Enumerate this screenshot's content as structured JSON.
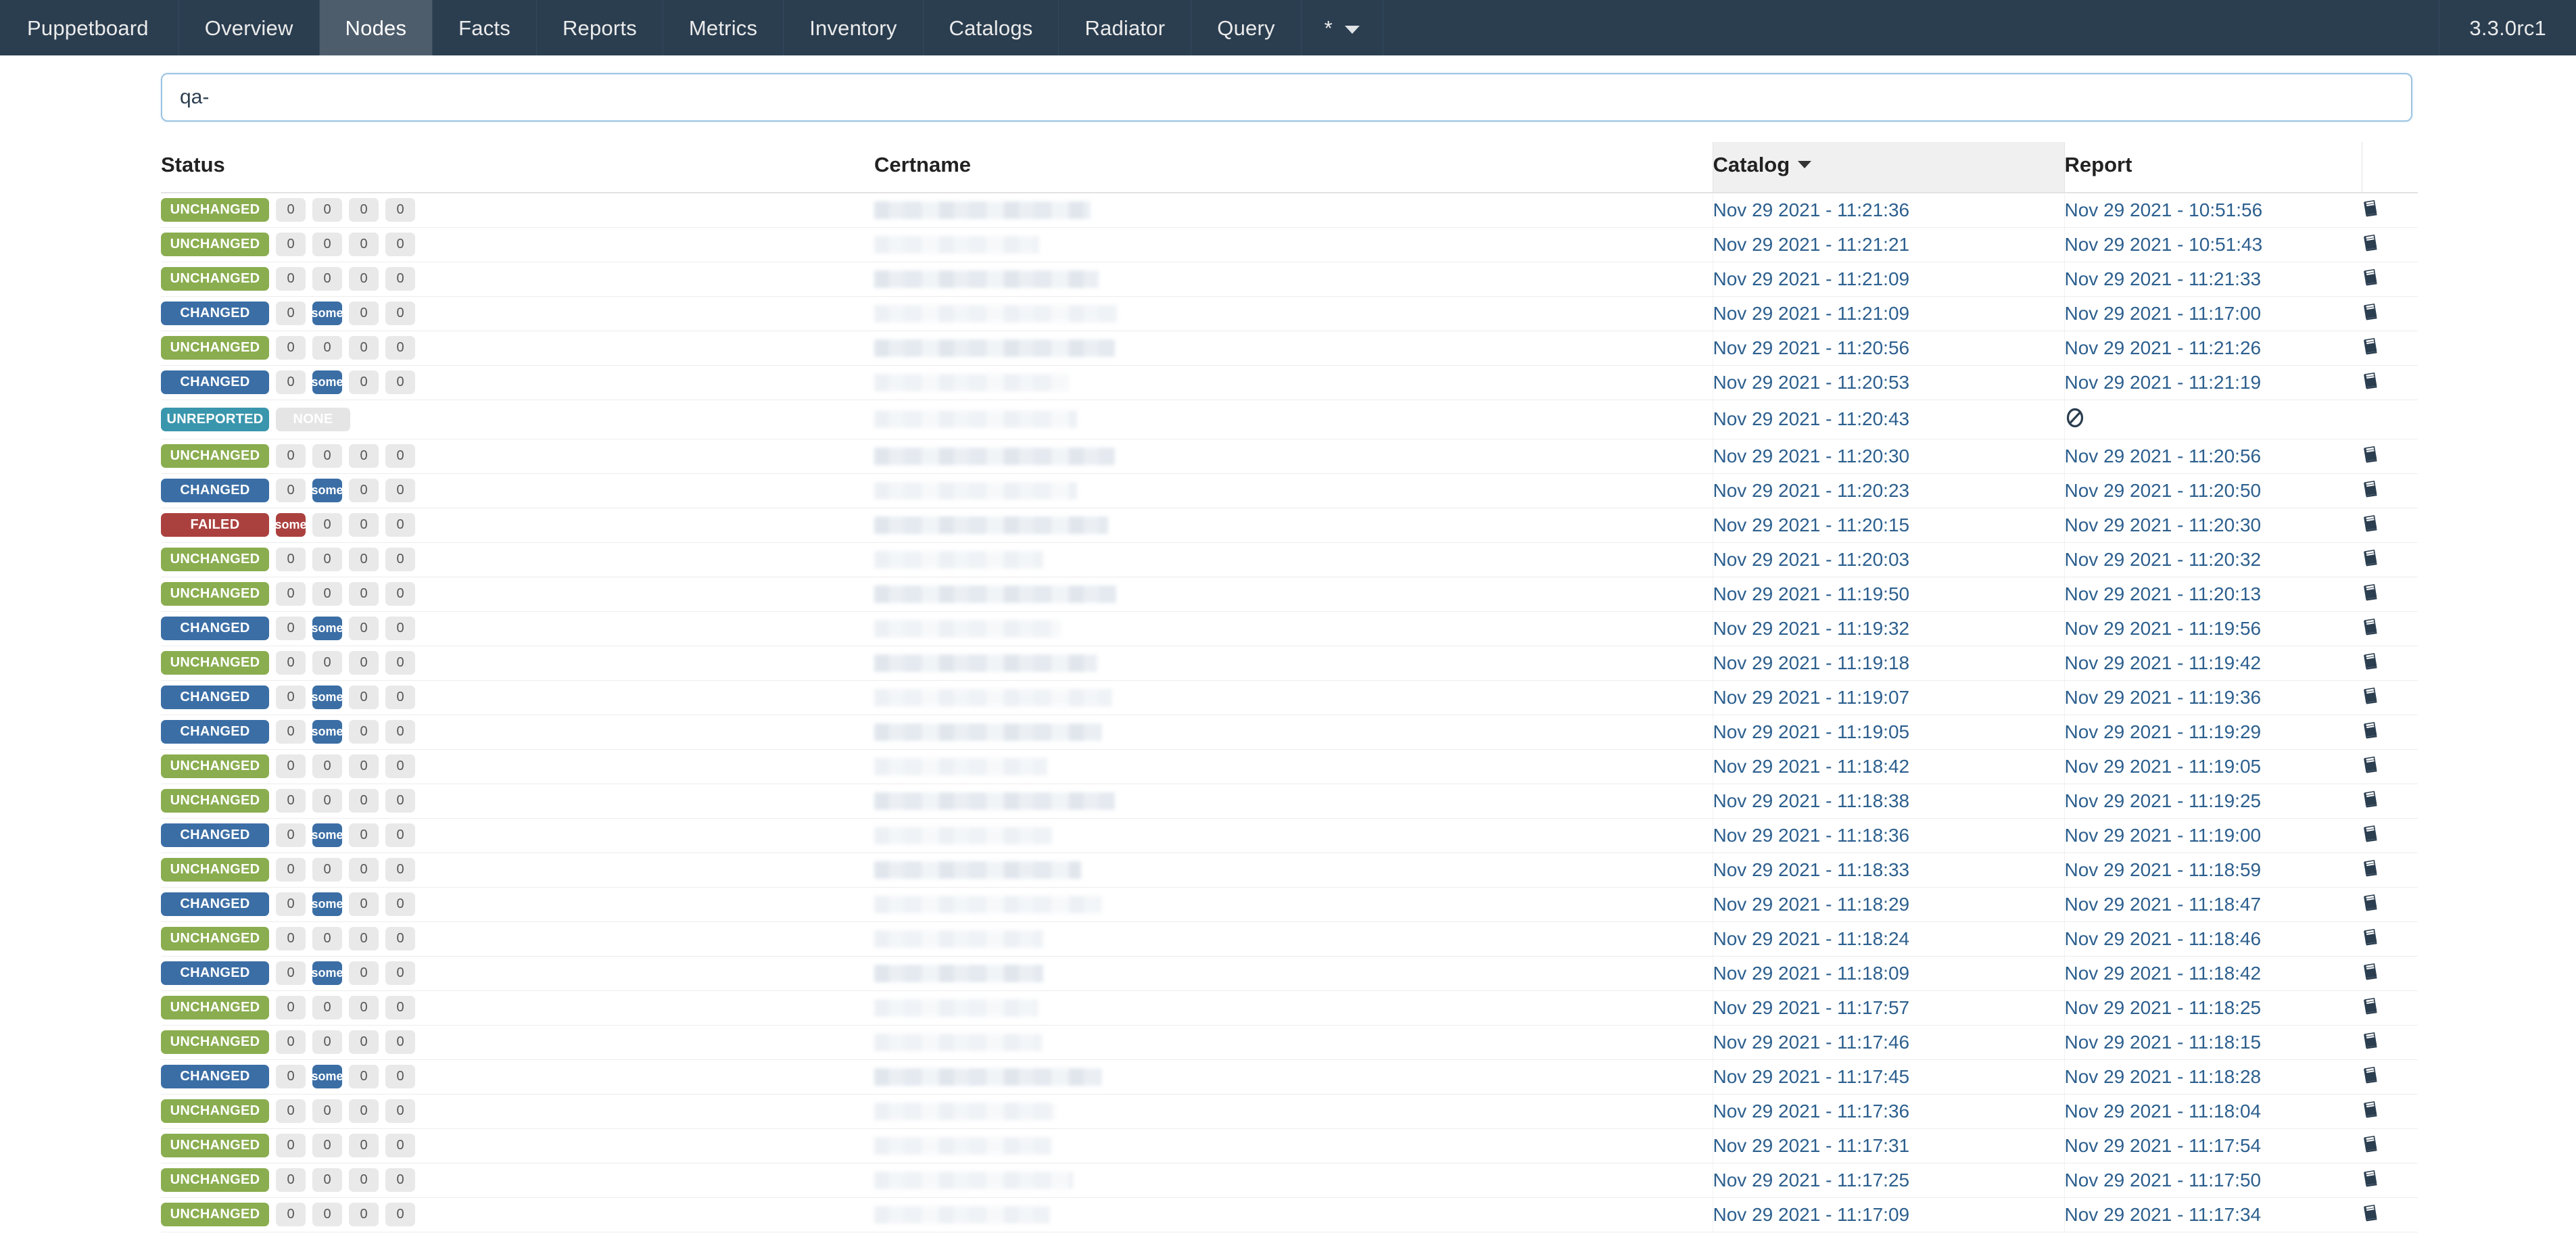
{
  "navbar": {
    "brand": "Puppetboard",
    "items": [
      {
        "label": "Overview",
        "active": false
      },
      {
        "label": "Nodes",
        "active": true
      },
      {
        "label": "Facts",
        "active": false
      },
      {
        "label": "Reports",
        "active": false
      },
      {
        "label": "Metrics",
        "active": false
      },
      {
        "label": "Inventory",
        "active": false
      },
      {
        "label": "Catalogs",
        "active": false
      },
      {
        "label": "Radiator",
        "active": false
      },
      {
        "label": "Query",
        "active": false
      }
    ],
    "env_dropdown_label": "*",
    "version": "3.3.0rc1",
    "colors": {
      "bar_bg": "#2b3e50",
      "active_bg": "#4e5d6c",
      "text": "#ebebeb"
    }
  },
  "search": {
    "value": "qa-",
    "placeholder": ""
  },
  "table": {
    "headers": {
      "status": "Status",
      "certname": "Certname",
      "catalog": "Catalog",
      "report": "Report",
      "logs": ""
    },
    "sorted_column": "catalog",
    "sort_direction": "desc",
    "icons": {
      "sort": "caret-down-icon",
      "logs": "book-icon",
      "no_report": "no-entry-icon"
    },
    "status_colors": {
      "unchanged": "#8aad4f",
      "changed": "#3b6ea5",
      "failed": "#ab413f",
      "unreported": "#3a96ad",
      "count_pill": "#e9e9e9"
    },
    "rows": [
      {
        "status": "UNCHANGED",
        "counts": [
          "0",
          "0",
          "0",
          "0"
        ],
        "certname_width": 320,
        "certname_tone": "solid",
        "catalog": "Nov 29 2021 - 11:21:36",
        "report": "Nov 29 2021 - 10:51:56",
        "has_log": true
      },
      {
        "status": "UNCHANGED",
        "counts": [
          "0",
          "0",
          "0",
          "0"
        ],
        "certname_width": 244,
        "certname_tone": "pale",
        "catalog": "Nov 29 2021 - 11:21:21",
        "report": "Nov 29 2021 - 10:51:43",
        "has_log": true
      },
      {
        "status": "UNCHANGED",
        "counts": [
          "0",
          "0",
          "0",
          "0"
        ],
        "certname_width": 332,
        "certname_tone": "solid",
        "catalog": "Nov 29 2021 - 11:21:09",
        "report": "Nov 29 2021 - 11:21:33",
        "has_log": true
      },
      {
        "status": "CHANGED",
        "counts": [
          "0",
          "some",
          "0",
          "0"
        ],
        "highlight_index": 1,
        "highlight_color": "blue",
        "certname_width": 360,
        "certname_tone": "pale",
        "catalog": "Nov 29 2021 - 11:21:09",
        "report": "Nov 29 2021 - 11:17:00",
        "has_log": true
      },
      {
        "status": "UNCHANGED",
        "counts": [
          "0",
          "0",
          "0",
          "0"
        ],
        "certname_width": 356,
        "certname_tone": "solid",
        "catalog": "Nov 29 2021 - 11:20:56",
        "report": "Nov 29 2021 - 11:21:26",
        "has_log": true
      },
      {
        "status": "CHANGED",
        "counts": [
          "0",
          "some",
          "0",
          "0"
        ],
        "highlight_index": 1,
        "highlight_color": "blue",
        "certname_width": 288,
        "certname_tone": "pale",
        "catalog": "Nov 29 2021 - 11:20:53",
        "report": "Nov 29 2021 - 11:21:19",
        "has_log": true
      },
      {
        "status": "UNREPORTED",
        "counts": [
          "NONE"
        ],
        "none_row": true,
        "certname_width": 300,
        "certname_tone": "pale",
        "catalog": "Nov 29 2021 - 11:20:43",
        "report": "",
        "has_log": false,
        "no_report_icon": true,
        "tall": true
      },
      {
        "status": "UNCHANGED",
        "counts": [
          "0",
          "0",
          "0",
          "0"
        ],
        "certname_width": 356,
        "certname_tone": "solid",
        "catalog": "Nov 29 2021 - 11:20:30",
        "report": "Nov 29 2021 - 11:20:56",
        "has_log": true
      },
      {
        "status": "CHANGED",
        "counts": [
          "0",
          "some",
          "0",
          "0"
        ],
        "highlight_index": 1,
        "highlight_color": "blue",
        "certname_width": 300,
        "certname_tone": "pale",
        "catalog": "Nov 29 2021 - 11:20:23",
        "report": "Nov 29 2021 - 11:20:50",
        "has_log": true
      },
      {
        "status": "FAILED",
        "counts": [
          "some",
          "0",
          "0",
          "0"
        ],
        "highlight_index": 0,
        "highlight_color": "red",
        "certname_width": 346,
        "certname_tone": "solid",
        "catalog": "Nov 29 2021 - 11:20:15",
        "report": "Nov 29 2021 - 11:20:30",
        "has_log": true
      },
      {
        "status": "UNCHANGED",
        "counts": [
          "0",
          "0",
          "0",
          "0"
        ],
        "certname_width": 250,
        "certname_tone": "pale",
        "catalog": "Nov 29 2021 - 11:20:03",
        "report": "Nov 29 2021 - 11:20:32",
        "has_log": true
      },
      {
        "status": "UNCHANGED",
        "counts": [
          "0",
          "0",
          "0",
          "0"
        ],
        "certname_width": 358,
        "certname_tone": "solid",
        "catalog": "Nov 29 2021 - 11:19:50",
        "report": "Nov 29 2021 - 11:20:13",
        "has_log": true
      },
      {
        "status": "CHANGED",
        "counts": [
          "0",
          "some",
          "0",
          "0"
        ],
        "highlight_index": 1,
        "highlight_color": "blue",
        "certname_width": 276,
        "certname_tone": "pale",
        "catalog": "Nov 29 2021 - 11:19:32",
        "report": "Nov 29 2021 - 11:19:56",
        "has_log": true
      },
      {
        "status": "UNCHANGED",
        "counts": [
          "0",
          "0",
          "0",
          "0"
        ],
        "certname_width": 330,
        "certname_tone": "solid",
        "catalog": "Nov 29 2021 - 11:19:18",
        "report": "Nov 29 2021 - 11:19:42",
        "has_log": true
      },
      {
        "status": "CHANGED",
        "counts": [
          "0",
          "some",
          "0",
          "0"
        ],
        "highlight_index": 1,
        "highlight_color": "blue",
        "certname_width": 352,
        "certname_tone": "pale",
        "catalog": "Nov 29 2021 - 11:19:07",
        "report": "Nov 29 2021 - 11:19:36",
        "has_log": true
      },
      {
        "status": "CHANGED",
        "counts": [
          "0",
          "some",
          "0",
          "0"
        ],
        "highlight_index": 1,
        "highlight_color": "blue",
        "certname_width": 336,
        "certname_tone": "solid",
        "catalog": "Nov 29 2021 - 11:19:05",
        "report": "Nov 29 2021 - 11:19:29",
        "has_log": true
      },
      {
        "status": "UNCHANGED",
        "counts": [
          "0",
          "0",
          "0",
          "0"
        ],
        "certname_width": 256,
        "certname_tone": "pale",
        "catalog": "Nov 29 2021 - 11:18:42",
        "report": "Nov 29 2021 - 11:19:05",
        "has_log": true
      },
      {
        "status": "UNCHANGED",
        "counts": [
          "0",
          "0",
          "0",
          "0"
        ],
        "certname_width": 356,
        "certname_tone": "solid",
        "catalog": "Nov 29 2021 - 11:18:38",
        "report": "Nov 29 2021 - 11:19:25",
        "has_log": true
      },
      {
        "status": "CHANGED",
        "counts": [
          "0",
          "some",
          "0",
          "0"
        ],
        "highlight_index": 1,
        "highlight_color": "blue",
        "certname_width": 264,
        "certname_tone": "pale",
        "catalog": "Nov 29 2021 - 11:18:36",
        "report": "Nov 29 2021 - 11:19:00",
        "has_log": true
      },
      {
        "status": "UNCHANGED",
        "counts": [
          "0",
          "0",
          "0",
          "0"
        ],
        "certname_width": 306,
        "certname_tone": "solid",
        "catalog": "Nov 29 2021 - 11:18:33",
        "report": "Nov 29 2021 - 11:18:59",
        "has_log": true
      },
      {
        "status": "CHANGED",
        "counts": [
          "0",
          "some",
          "0",
          "0"
        ],
        "highlight_index": 1,
        "highlight_color": "blue",
        "certname_width": 336,
        "certname_tone": "pale",
        "catalog": "Nov 29 2021 - 11:18:29",
        "report": "Nov 29 2021 - 11:18:47",
        "has_log": true
      },
      {
        "status": "UNCHANGED",
        "counts": [
          "0",
          "0",
          "0",
          "0"
        ],
        "certname_width": 250,
        "certname_tone": "pale",
        "catalog": "Nov 29 2021 - 11:18:24",
        "report": "Nov 29 2021 - 11:18:46",
        "has_log": true
      },
      {
        "status": "CHANGED",
        "counts": [
          "0",
          "some",
          "0",
          "0"
        ],
        "highlight_index": 1,
        "highlight_color": "blue",
        "certname_width": 250,
        "certname_tone": "solid",
        "catalog": "Nov 29 2021 - 11:18:09",
        "report": "Nov 29 2021 - 11:18:42",
        "has_log": true
      },
      {
        "status": "UNCHANGED",
        "counts": [
          "0",
          "0",
          "0",
          "0"
        ],
        "certname_width": 242,
        "certname_tone": "pale",
        "catalog": "Nov 29 2021 - 11:17:57",
        "report": "Nov 29 2021 - 11:18:25",
        "has_log": true
      },
      {
        "status": "UNCHANGED",
        "counts": [
          "0",
          "0",
          "0",
          "0"
        ],
        "certname_width": 248,
        "certname_tone": "pale",
        "catalog": "Nov 29 2021 - 11:17:46",
        "report": "Nov 29 2021 - 11:18:15",
        "has_log": true
      },
      {
        "status": "CHANGED",
        "counts": [
          "0",
          "some",
          "0",
          "0"
        ],
        "highlight_index": 1,
        "highlight_color": "blue",
        "certname_width": 336,
        "certname_tone": "solid",
        "catalog": "Nov 29 2021 - 11:17:45",
        "report": "Nov 29 2021 - 11:18:28",
        "has_log": true
      },
      {
        "status": "UNCHANGED",
        "counts": [
          "0",
          "0",
          "0",
          "0"
        ],
        "certname_width": 268,
        "certname_tone": "pale",
        "catalog": "Nov 29 2021 - 11:17:36",
        "report": "Nov 29 2021 - 11:18:04",
        "has_log": true
      },
      {
        "status": "UNCHANGED",
        "counts": [
          "0",
          "0",
          "0",
          "0"
        ],
        "certname_width": 262,
        "certname_tone": "pale",
        "catalog": "Nov 29 2021 - 11:17:31",
        "report": "Nov 29 2021 - 11:17:54",
        "has_log": true
      },
      {
        "status": "UNCHANGED",
        "counts": [
          "0",
          "0",
          "0",
          "0"
        ],
        "certname_width": 294,
        "certname_tone": "pale",
        "catalog": "Nov 29 2021 - 11:17:25",
        "report": "Nov 29 2021 - 11:17:50",
        "has_log": true
      },
      {
        "status": "UNCHANGED",
        "counts": [
          "0",
          "0",
          "0",
          "0"
        ],
        "certname_width": 260,
        "certname_tone": "pale",
        "catalog": "Nov 29 2021 - 11:17:09",
        "report": "Nov 29 2021 - 11:17:34",
        "has_log": true
      }
    ]
  }
}
